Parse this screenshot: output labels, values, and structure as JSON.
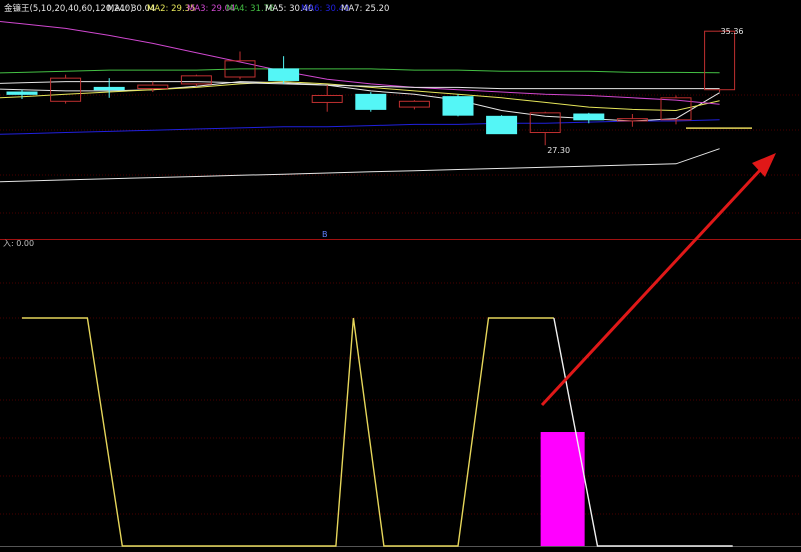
{
  "colors": {
    "background": "#000000",
    "grid": "#4a0000",
    "divider": "#a01010",
    "bull": "#c03030",
    "bear": "#54f6f6",
    "ma1": "#e6e6e6",
    "ma2": "#e6e65a",
    "ma3": "#d048d0",
    "ma4": "#44c044",
    "ma5": "#e6e6e6",
    "ma6": "#2020dd",
    "ma7": "#e6e6e6",
    "signal_yellow": "#e6d65a",
    "signal_white": "#f0f0f0",
    "highlight_bar": "#ff00ff",
    "arrow": "#e01818",
    "label_dim": "#c0c0c0"
  },
  "header": {
    "title": "金镰王(5,10,20,40,60,120,240)",
    "ma_labels": [
      {
        "key": "MA1",
        "text": "MA1: 30.04",
        "color": "#e6e6e6"
      },
      {
        "key": "MA2",
        "text": "MA2: 29.35",
        "color": "#e6e65a"
      },
      {
        "key": "MA3",
        "text": "MA3: 29.04",
        "color": "#d048d0"
      },
      {
        "key": "MA4",
        "text": "MA4: 31.76",
        "color": "#44c044"
      },
      {
        "key": "MA5",
        "text": "MA5: 30.40",
        "color": "#e6e6e6"
      },
      {
        "key": "MA6",
        "text": "MA6: 30.40",
        "color": "#2020dd"
      },
      {
        "key": "MA7",
        "text": "MA7: 25.20",
        "color": "#e6e6e6"
      }
    ]
  },
  "annotations": {
    "high_label": "35.36",
    "low_label": "27.30",
    "indicator_label": "入: 0.00",
    "marker_label": "B"
  },
  "chart_data": [
    {
      "type": "candlestick",
      "title": "金镰王(5,10,20,40,60,120,240)",
      "ylim": [
        18,
        36.5
      ],
      "x": [
        0,
        1,
        2,
        3,
        4,
        5,
        6,
        7,
        8,
        9,
        10,
        11,
        12,
        13,
        14,
        15,
        16
      ],
      "candles": [
        {
          "open": 30.1,
          "close": 29.9,
          "high": 30.3,
          "low": 29.5
        },
        {
          "open": 29.3,
          "close": 31.3,
          "high": 31.6,
          "low": 29.1
        },
        {
          "open": 30.5,
          "close": 30.3,
          "high": 31.3,
          "low": 29.6
        },
        {
          "open": 30.4,
          "close": 30.7,
          "high": 31.0,
          "low": 30.1
        },
        {
          "open": 30.8,
          "close": 31.5,
          "high": 31.6,
          "low": 30.6
        },
        {
          "open": 31.4,
          "close": 32.8,
          "high": 33.6,
          "low": 31.2
        },
        {
          "open": 32.1,
          "close": 31.1,
          "high": 33.2,
          "low": 30.8
        },
        {
          "open": 29.2,
          "close": 29.8,
          "high": 30.7,
          "low": 28.4
        },
        {
          "open": 29.9,
          "close": 28.6,
          "high": 30.1,
          "low": 28.4
        },
        {
          "open": 28.8,
          "close": 29.3,
          "high": 29.4,
          "low": 28.6
        },
        {
          "open": 29.7,
          "close": 28.1,
          "high": 29.9,
          "low": 28.0
        },
        {
          "open": 28.0,
          "close": 26.5,
          "high": 28.1,
          "low": 26.5
        },
        {
          "open": 26.6,
          "close": 28.3,
          "high": 28.4,
          "low": 25.5
        },
        {
          "open": 28.2,
          "close": 27.7,
          "high": 28.3,
          "low": 27.4
        },
        {
          "open": 27.6,
          "close": 27.8,
          "high": 28.2,
          "low": 27.1
        },
        {
          "open": 27.7,
          "close": 29.6,
          "high": 29.8,
          "low": 27.3
        },
        {
          "open": 30.3,
          "close": 35.36,
          "high": 35.4,
          "low": 30.1
        }
      ],
      "series": [
        {
          "name": "MA1",
          "color": "#e6e6e6",
          "values": [
            30.3,
            30.2,
            30.2,
            30.3,
            30.6,
            31.0,
            30.9,
            30.7,
            30.2,
            29.9,
            29.4,
            28.5,
            28.0,
            27.8,
            27.6,
            27.8,
            30.04
          ]
        },
        {
          "name": "MA2",
          "color": "#e6e65a",
          "values": [
            29.7,
            29.9,
            30.1,
            30.3,
            30.5,
            30.8,
            31.0,
            30.8,
            30.5,
            30.2,
            29.9,
            29.6,
            29.2,
            28.8,
            28.6,
            28.5,
            29.35
          ]
        },
        {
          "name": "MA3",
          "color": "#d048d0",
          "values": [
            36.0,
            35.6,
            35.0,
            34.3,
            33.5,
            32.7,
            31.9,
            31.2,
            30.8,
            30.5,
            30.3,
            30.1,
            29.9,
            29.8,
            29.6,
            29.4,
            29.04
          ]
        },
        {
          "name": "MA4",
          "color": "#44c044",
          "values": [
            31.8,
            31.9,
            32.0,
            32.0,
            32.0,
            32.1,
            32.1,
            32.1,
            32.1,
            32.0,
            32.0,
            31.9,
            31.9,
            31.9,
            31.8,
            31.8,
            31.76
          ]
        },
        {
          "name": "MA5",
          "color": "#e6e6e6",
          "values": [
            30.9,
            31.0,
            31.0,
            31.0,
            31.0,
            30.9,
            30.8,
            30.7,
            30.6,
            30.5,
            30.5,
            30.4,
            30.4,
            30.4,
            30.4,
            30.4,
            30.4
          ]
        },
        {
          "name": "MA6",
          "color": "#2020dd",
          "values": [
            26.5,
            26.6,
            26.7,
            26.8,
            26.9,
            27.0,
            27.1,
            27.1,
            27.2,
            27.3,
            27.3,
            27.4,
            27.4,
            27.5,
            27.6,
            27.6,
            27.7
          ]
        },
        {
          "name": "MA7",
          "color": "#e6e6e6",
          "values": [
            22.4,
            22.5,
            22.6,
            22.7,
            22.8,
            22.9,
            23.0,
            23.1,
            23.2,
            23.3,
            23.4,
            23.5,
            23.6,
            23.7,
            23.8,
            23.9,
            25.2
          ]
        }
      ]
    },
    {
      "type": "line",
      "ylim": [
        0,
        1
      ],
      "series": [
        {
          "name": "",
          "color": "#e6d65a",
          "x": [
            0,
            1.5,
            2.3,
            7.2,
            7.6,
            8.3,
            10.0,
            10.7,
            12.2
          ],
          "values": [
            1,
            1,
            0,
            0,
            1,
            0,
            0,
            1,
            1
          ]
        },
        {
          "name": "",
          "color": "#f0f0f0",
          "x": [
            12.2,
            13.2,
            16.3
          ],
          "values": [
            1,
            0,
            0
          ]
        }
      ],
      "bars": [
        {
          "x": 12.4,
          "value": 0.5,
          "color": "#ff00ff"
        }
      ]
    }
  ]
}
